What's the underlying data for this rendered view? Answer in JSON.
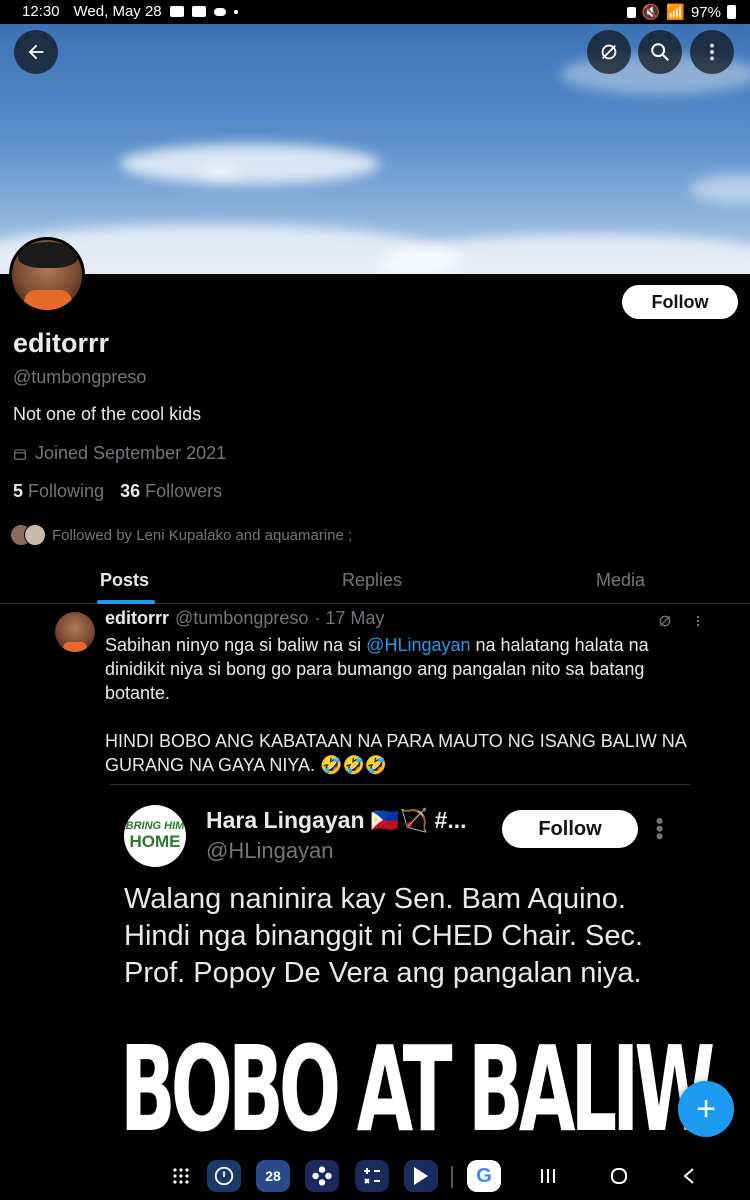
{
  "status_bar": {
    "time": "12:30",
    "date": "Wed, May 28",
    "battery": "97%"
  },
  "profile": {
    "name": "editorrr",
    "handle": "@tumbongpreso",
    "bio": "Not one of the cool kids",
    "joined": "Joined September 2021",
    "following_count": "5",
    "following_label": "Following",
    "followers_count": "36",
    "followers_label": "Followers",
    "followed_by": "Followed by Leni Kupalako and aquamarine ;",
    "follow_label": "Follow"
  },
  "tabs": [
    "Posts",
    "Replies",
    "Media"
  ],
  "tweet": {
    "author": "editorrr",
    "handle": "@tumbongpreso",
    "date": "· 17 May",
    "text_part1": "Sabihan ninyo nga si baliw na si ",
    "mention": "@HLingayan",
    "text_part2": " na halatang halata na dinidikit niya si bong go para bumango ang pangalan nito sa batang botante.",
    "text_line2": "HINDI BOBO ANG KABATAAN NA PARA MAUTO NG ISANG BALIW NA GURANG NA GAYA NIYA. 🤣🤣🤣"
  },
  "embedded": {
    "avatar_line1": "BRING HIM",
    "avatar_line2": "HOME",
    "name": "Hara Lingayan 🇵🇭🏹 #...",
    "handle": "@HLingayan",
    "follow_label": "Follow",
    "text": "Walang naninira kay Sen. Bam Aquino. Hindi nga binanggit ni CHED Chair. Sec. Prof. Popoy De Vera ang pangalan niya.",
    "overlay_caption": "BOBO AT BALIW"
  },
  "fab_label": "+",
  "nav": {
    "calendar_day": "28"
  },
  "colors": {
    "accent": "#1d9bf0",
    "background": "#000000",
    "muted": "#71767b"
  }
}
